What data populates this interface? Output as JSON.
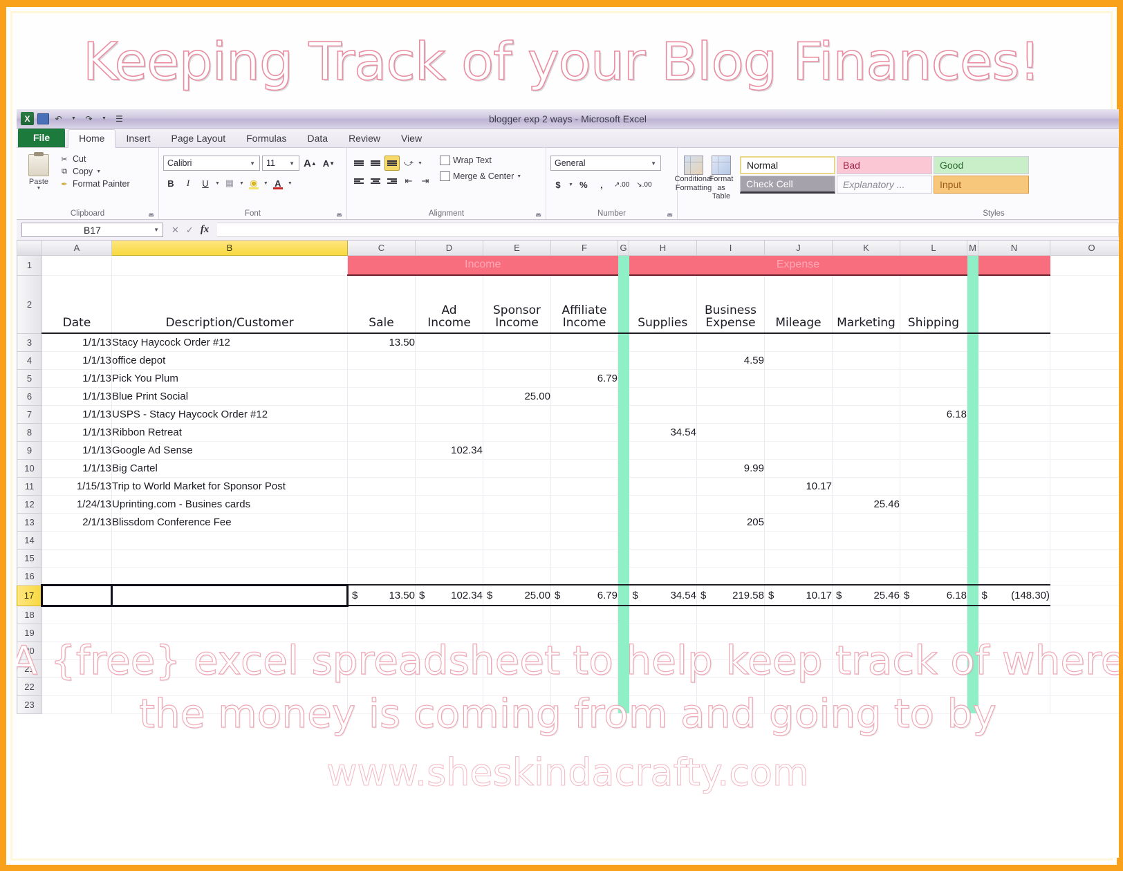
{
  "banner": {
    "title": "Keeping Track of your Blog Finances!"
  },
  "window": {
    "title": "blogger exp 2 ways - Microsoft Excel"
  },
  "quick_access": {
    "save": "save-icon",
    "undo": "undo-icon",
    "redo": "redo-icon",
    "customize": "customize-icon"
  },
  "tabs": [
    {
      "label": "File"
    },
    {
      "label": "Home"
    },
    {
      "label": "Insert"
    },
    {
      "label": "Page Layout"
    },
    {
      "label": "Formulas"
    },
    {
      "label": "Data"
    },
    {
      "label": "Review"
    },
    {
      "label": "View"
    }
  ],
  "ribbon": {
    "clipboard": {
      "group_label": "Clipboard",
      "paste": "Paste",
      "cut": "Cut",
      "copy": "Copy",
      "format_painter": "Format Painter"
    },
    "font": {
      "group_label": "Font",
      "font_name": "Calibri",
      "font_size": "11",
      "grow": "A",
      "shrink": "A",
      "bold": "B",
      "italic": "I",
      "underline": "U",
      "fill_color": "A",
      "font_color": "A"
    },
    "alignment": {
      "group_label": "Alignment",
      "wrap_text": "Wrap Text",
      "merge_center": "Merge & Center"
    },
    "number": {
      "group_label": "Number",
      "format": "General",
      "currency": "$",
      "percent": "%",
      "comma": ",",
      "inc_dec": ".00",
      "dec_dec": ".00"
    },
    "styles": {
      "group_label": "Styles",
      "conditional_formatting": "Conditional Formatting",
      "format_as_table": "Format as Table",
      "gallery": [
        {
          "label": "Normal"
        },
        {
          "label": "Bad"
        },
        {
          "label": "Good"
        },
        {
          "label": "Check Cell"
        },
        {
          "label": "Explanatory ..."
        },
        {
          "label": "Input"
        }
      ]
    }
  },
  "formula_bar": {
    "name_box": "B17",
    "formula": ""
  },
  "sheet": {
    "columns": [
      "A",
      "B",
      "C",
      "D",
      "E",
      "F",
      "G",
      "H",
      "I",
      "J",
      "K",
      "L",
      "M",
      "N",
      "O"
    ],
    "selected_column": "B",
    "selected_row": "17",
    "row_numbers": [
      "1",
      "2",
      "3",
      "4",
      "5",
      "6",
      "7",
      "8",
      "9",
      "10",
      "11",
      "12",
      "13",
      "14",
      "15",
      "16",
      "17",
      "18",
      "19",
      "20",
      "21",
      "22",
      "23"
    ],
    "group_headers": {
      "income": "Income",
      "expense": "Expense"
    },
    "headers": {
      "date": "Date",
      "description": "Description/Customer",
      "sale": "Sale",
      "ad_income_1": "Ad",
      "ad_income_2": "Income",
      "sponsor_income_1": "Sponsor",
      "sponsor_income_2": "Income",
      "affiliate_income_1": "Affiliate",
      "affiliate_income_2": "Income",
      "supplies": "Supplies",
      "business_expense_1": "Business",
      "business_expense_2": "Expense",
      "mileage": "Mileage",
      "marketing": "Marketing",
      "shipping": "Shipping"
    },
    "rows": [
      {
        "n": "3",
        "date": "1/1/13",
        "desc": "Stacy Haycock Order #12",
        "sale": "13.50",
        "ad": "",
        "sponsor": "",
        "affiliate": "",
        "supplies": "",
        "business": "",
        "mileage": "",
        "marketing": "",
        "shipping": ""
      },
      {
        "n": "4",
        "date": "1/1/13",
        "desc": "office depot",
        "sale": "",
        "ad": "",
        "sponsor": "",
        "affiliate": "",
        "supplies": "",
        "business": "4.59",
        "mileage": "",
        "marketing": "",
        "shipping": ""
      },
      {
        "n": "5",
        "date": "1/1/13",
        "desc": "Pick You Plum",
        "sale": "",
        "ad": "",
        "sponsor": "",
        "affiliate": "6.79",
        "supplies": "",
        "business": "",
        "mileage": "",
        "marketing": "",
        "shipping": ""
      },
      {
        "n": "6",
        "date": "1/1/13",
        "desc": "Blue Print Social",
        "sale": "",
        "ad": "",
        "sponsor": "25.00",
        "affiliate": "",
        "supplies": "",
        "business": "",
        "mileage": "",
        "marketing": "",
        "shipping": ""
      },
      {
        "n": "7",
        "date": "1/1/13",
        "desc": "USPS - Stacy Haycock Order #12",
        "sale": "",
        "ad": "",
        "sponsor": "",
        "affiliate": "",
        "supplies": "",
        "business": "",
        "mileage": "",
        "marketing": "",
        "shipping": "6.18"
      },
      {
        "n": "8",
        "date": "1/1/13",
        "desc": "Ribbon Retreat",
        "sale": "",
        "ad": "",
        "sponsor": "",
        "affiliate": "",
        "supplies": "34.54",
        "business": "",
        "mileage": "",
        "marketing": "",
        "shipping": ""
      },
      {
        "n": "9",
        "date": "1/1/13",
        "desc": "Google Ad Sense",
        "sale": "",
        "ad": "102.34",
        "sponsor": "",
        "affiliate": "",
        "supplies": "",
        "business": "",
        "mileage": "",
        "marketing": "",
        "shipping": ""
      },
      {
        "n": "10",
        "date": "1/1/13",
        "desc": "Big Cartel",
        "sale": "",
        "ad": "",
        "sponsor": "",
        "affiliate": "",
        "supplies": "",
        "business": "9.99",
        "mileage": "",
        "marketing": "",
        "shipping": ""
      },
      {
        "n": "11",
        "date": "1/15/13",
        "desc": "Trip to World Market for Sponsor Post",
        "sale": "",
        "ad": "",
        "sponsor": "",
        "affiliate": "",
        "supplies": "",
        "business": "",
        "mileage": "10.17",
        "marketing": "",
        "shipping": ""
      },
      {
        "n": "12",
        "date": "1/24/13",
        "desc": "Uprinting.com - Busines cards",
        "sale": "",
        "ad": "",
        "sponsor": "",
        "affiliate": "",
        "supplies": "",
        "business": "",
        "mileage": "",
        "marketing": "25.46",
        "shipping": ""
      },
      {
        "n": "13",
        "date": "2/1/13",
        "desc": "Blissdom Conference Fee",
        "sale": "",
        "ad": "",
        "sponsor": "",
        "affiliate": "",
        "supplies": "",
        "business": "205",
        "mileage": "",
        "marketing": "",
        "shipping": ""
      },
      {
        "n": "14",
        "date": "",
        "desc": "",
        "sale": "",
        "ad": "",
        "sponsor": "",
        "affiliate": "",
        "supplies": "",
        "business": "",
        "mileage": "",
        "marketing": "",
        "shipping": ""
      },
      {
        "n": "15",
        "date": "",
        "desc": "",
        "sale": "",
        "ad": "",
        "sponsor": "",
        "affiliate": "",
        "supplies": "",
        "business": "",
        "mileage": "",
        "marketing": "",
        "shipping": ""
      },
      {
        "n": "16",
        "date": "",
        "desc": "",
        "sale": "",
        "ad": "",
        "sponsor": "",
        "affiliate": "",
        "supplies": "",
        "business": "",
        "mileage": "",
        "marketing": "",
        "shipping": ""
      }
    ],
    "totals": {
      "n": "17",
      "currency": "$",
      "sale": "13.50",
      "ad": "102.34",
      "sponsor": "25.00",
      "affiliate": "6.79",
      "supplies": "34.54",
      "business": "219.58",
      "mileage": "10.17",
      "marketing": "25.46",
      "shipping": "6.18",
      "net": "(148.30)"
    },
    "trailing_rows": [
      "18",
      "19",
      "20",
      "21",
      "22",
      "23"
    ]
  },
  "caption": {
    "line1": "A {free} excel spreadsheet to help keep track of where",
    "line2": "the money is coming from and going to by",
    "url": "www.sheskindacrafty.com"
  },
  "colors": {
    "frame": "#f9a11b",
    "header_pink": "#f96e7f",
    "title_pink": "#ea8fa2",
    "separator_green": "#8ff0c8",
    "selection_yellow": "#f7d93f"
  }
}
